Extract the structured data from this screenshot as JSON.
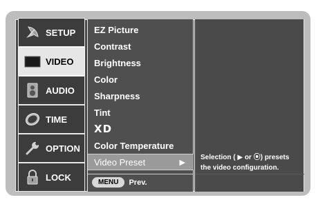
{
  "tabs": [
    {
      "label": "SETUP",
      "icon": "satellite-dish-icon"
    },
    {
      "label": "VIDEO",
      "icon": "tv-screen-icon",
      "active": true
    },
    {
      "label": "AUDIO",
      "icon": "speaker-icon"
    },
    {
      "label": "TIME",
      "icon": "clock-icon"
    },
    {
      "label": "OPTION",
      "icon": "wrench-icon"
    },
    {
      "label": "LOCK",
      "icon": "padlock-icon"
    }
  ],
  "video_menu": {
    "items": [
      "EZ Picture",
      "Contrast",
      "Brightness",
      "Color",
      "Sharpness",
      "Tint",
      "XD",
      "Color Temperature",
      "Video Preset"
    ],
    "selected_index": 8,
    "selected_arrow": "▶"
  },
  "footer": {
    "menu_button": "MENU",
    "prev_label": "Prev."
  },
  "help": {
    "text": "Selection ( ▶ or ⦿) presets the video configuration."
  },
  "colors": {
    "panel": "#4a4a4a",
    "frame": "#bdbdbd",
    "active_tab": "#e6e6e6",
    "selected_item": "#9a9a9a"
  }
}
